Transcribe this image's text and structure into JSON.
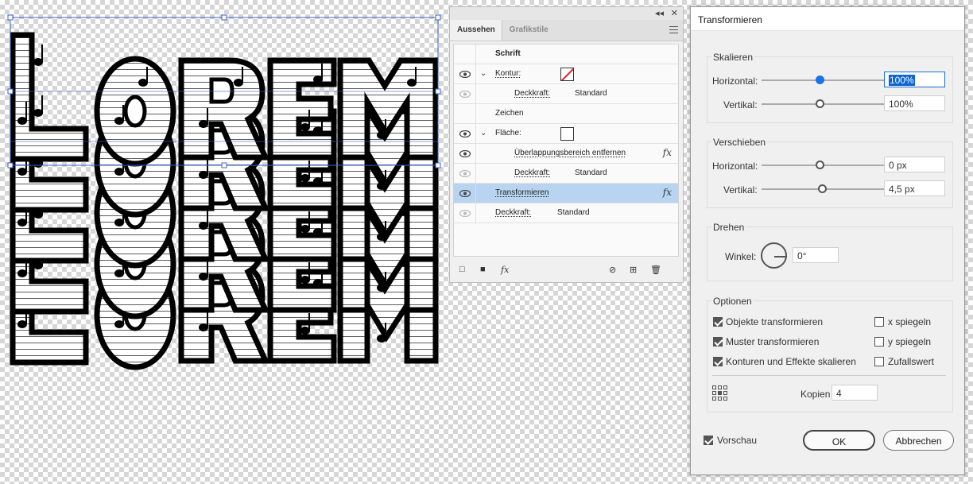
{
  "appearance_panel": {
    "tabs": [
      "Aussehen",
      "Grafikstile"
    ],
    "window_controls": {
      "collapse": "◂◂",
      "close": "✕"
    },
    "rows": [
      {
        "label": "Schrift",
        "bold": true
      },
      {
        "label": "Kontur:",
        "eye": true,
        "chevron": "⌄"
      },
      {
        "label": "Deckkraft:",
        "value": "Standard",
        "eye_dim": true
      },
      {
        "label": "Zeichen"
      },
      {
        "label": "Fläche:",
        "eye": true,
        "chevron": "⌄"
      },
      {
        "label": "Überlappungsbereich entfernen",
        "fx": "fx",
        "eye": true
      },
      {
        "label": "Deckkraft:",
        "value": "Standard",
        "eye_dim": true
      },
      {
        "label": "Transformieren",
        "fx": "fx",
        "eye": true,
        "selected": true
      },
      {
        "label": "Deckkraft:",
        "value": "Standard",
        "eye_dim": true
      }
    ],
    "footer_icons": [
      "□",
      "■",
      "fx",
      "⊘",
      "⊞",
      "🗑"
    ]
  },
  "dialog": {
    "title": "Transformieren",
    "skalieren": {
      "title": "Skalieren",
      "horizontal_label": "Horizontal:",
      "horizontal_value": "100%",
      "vertical_label": "Vertikal:",
      "vertical_value": "100%"
    },
    "verschieben": {
      "title": "Verschieben",
      "horizontal_label": "Horizontal:",
      "horizontal_value": "0 px",
      "vertical_label": "Vertikal:",
      "vertical_value": "4,5 px"
    },
    "drehen": {
      "title": "Drehen",
      "winkel_label": "Winkel:",
      "winkel_value": "0°"
    },
    "optionen": {
      "title": "Optionen",
      "objekte": "Objekte transformieren",
      "muster": "Muster transformieren",
      "konturen": "Konturen und Effekte skalieren",
      "x_spiegeln": "x spiegeln",
      "y_spiegeln": "y spiegeln",
      "zufallswert": "Zufallswert",
      "kopien_label": "Kopien",
      "kopien_value": "4"
    },
    "vorschau": "Vorschau",
    "ok": "OK",
    "abbrechen": "Abbrechen"
  },
  "artwork": {
    "text": "LOREM"
  },
  "colors": {
    "selection": "#3d63c9",
    "accent_blue": "#1a73e8",
    "row_selected": "#b8d4f0"
  }
}
